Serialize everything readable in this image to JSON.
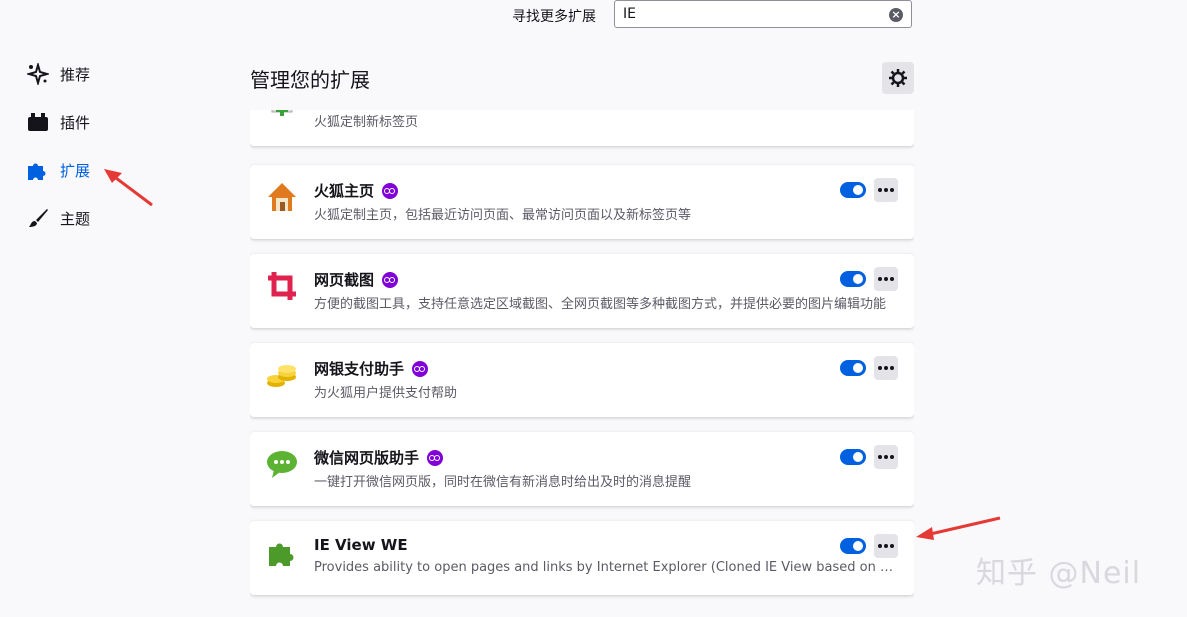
{
  "search": {
    "label": "寻找更多扩展",
    "value": "IE"
  },
  "sidebar": {
    "items": [
      {
        "label": "推荐",
        "icon": "sparkle-icon"
      },
      {
        "label": "插件",
        "icon": "plugin-icon"
      },
      {
        "label": "扩展",
        "icon": "puzzle-icon",
        "active": true
      },
      {
        "label": "主题",
        "icon": "brush-icon"
      }
    ]
  },
  "main": {
    "title": "管理您的扩展",
    "extensions": [
      {
        "name": "",
        "desc": "火狐定制新标签页",
        "icon": "newtab-icon",
        "enabled": true
      },
      {
        "name": "火狐主页",
        "desc": "火狐定制主页，包括最近访问页面、最常访问页面以及新标签页等",
        "icon": "home-icon",
        "enabled": true,
        "private": true
      },
      {
        "name": "网页截图",
        "desc": "方便的截图工具，支持任意选定区域截图、全网页截图等多种截图方式，并提供必要的图片编辑功能",
        "icon": "crop-icon",
        "enabled": true,
        "private": true
      },
      {
        "name": "网银支付助手",
        "desc": "为火狐用户提供支付帮助",
        "icon": "coins-icon",
        "enabled": true,
        "private": true
      },
      {
        "name": "微信网页版助手",
        "desc": "一键打开微信网页版，同时在微信有新消息时给出及时的消息提醒",
        "icon": "wechat-icon",
        "enabled": true,
        "private": true
      },
      {
        "name": "IE View WE",
        "desc": "Provides ability to open pages and links by Internet Explorer (Cloned IE View based on WebExtensions)",
        "icon": "puzzle-green-icon",
        "enabled": true,
        "private": false
      }
    ]
  },
  "watermark": "知乎 @Neil",
  "colors": {
    "accent": "#0061e0",
    "private_badge": "#8000d7",
    "arrow": "#e53935"
  }
}
